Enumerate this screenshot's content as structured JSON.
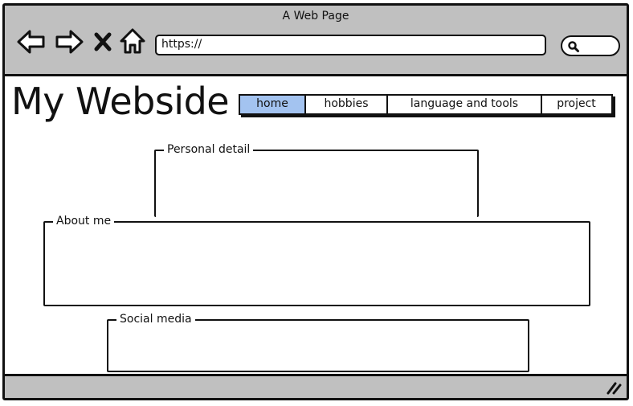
{
  "window": {
    "title": "A Web Page",
    "url": "https://"
  },
  "toolbar": {
    "icons": [
      "back-arrow-icon",
      "forward-arrow-icon",
      "close-x-icon",
      "home-icon",
      "search-icon"
    ]
  },
  "site": {
    "title": "My Webside"
  },
  "nav": {
    "tabs": [
      {
        "label": "home",
        "active": true
      },
      {
        "label": "hobbies",
        "active": false
      },
      {
        "label": "language and tools",
        "active": false
      },
      {
        "label": "project",
        "active": false
      }
    ]
  },
  "sections": {
    "personal_detail": "Personal detail",
    "about_me": "About me",
    "social_media": "Social media"
  },
  "colors": {
    "chrome": "#c0c0c0",
    "active_tab": "#a3c3f0",
    "stroke": "#111111"
  }
}
